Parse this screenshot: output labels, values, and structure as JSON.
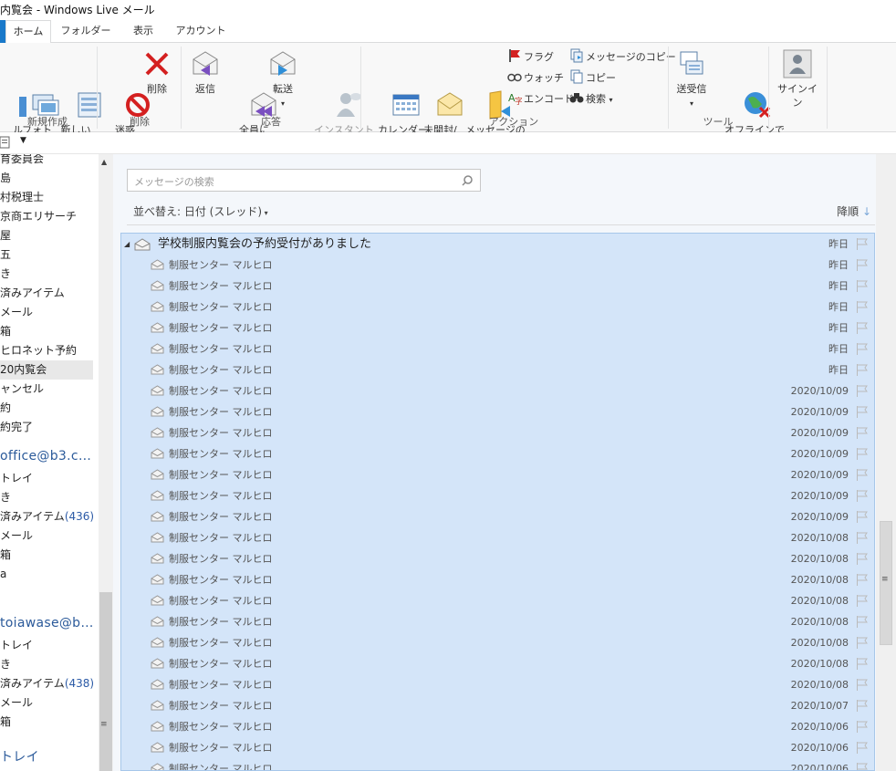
{
  "window": {
    "title": "内覧会 - Windows Live メール"
  },
  "tabs": [
    {
      "label": "ホーム",
      "active": true
    },
    {
      "label": "フォルダー"
    },
    {
      "label": "表示"
    },
    {
      "label": "アカウント"
    }
  ],
  "ribbon": {
    "new_group": {
      "btn1": "フォト\nメール",
      "btn2": "新しい\nアイテム",
      "label": "新規作成",
      "partial_left": "ル\nニ"
    },
    "delete_group": {
      "junk": "迷惑\nメール",
      "delete": "削除",
      "label": "削除"
    },
    "respond_group": {
      "reply": "返信",
      "reply_all": "全員に\n返信",
      "forward": "転送",
      "im": "インスタント\nメッセージ",
      "label": "応答"
    },
    "actions_group": {
      "calendar": "カレンダー\nに追加",
      "unread": "未開封/\n開封",
      "move": "メッセージの\n移動",
      "flag": "フラグ",
      "watch": "ウォッチ",
      "encode": "エンコード",
      "copy_msg": "メッセージのコピー",
      "copy": "コピー",
      "search": "検索",
      "label": "アクション"
    },
    "tools_group": {
      "sendrecv": "送受信",
      "offline": "オフラインで\n作業",
      "label": "ツール"
    },
    "signin": {
      "label": "サインイン"
    }
  },
  "folders": [
    {
      "label": "育委員会"
    },
    {
      "label": "島"
    },
    {
      "label": "村税理士"
    },
    {
      "label": "京商エリサーチ"
    },
    {
      "label": "屋"
    },
    {
      "label": "五"
    },
    {
      "label": "き"
    },
    {
      "label": "済みアイテム"
    },
    {
      "label": "メール"
    },
    {
      "label": "箱"
    },
    {
      "label": "ヒロネット予約"
    },
    {
      "label": "20内覧会",
      "selected": true
    },
    {
      "label": "ャンセル"
    },
    {
      "label": "約"
    },
    {
      "label": "約完了"
    }
  ],
  "account1": {
    "name": "office@b3.c…",
    "folders": [
      {
        "label": "トレイ"
      },
      {
        "label": "き"
      },
      {
        "label": "済みアイテム",
        "count": "(436)"
      },
      {
        "label": "メール"
      },
      {
        "label": "箱"
      },
      {
        "label": "a"
      }
    ]
  },
  "account2": {
    "name": "toiawase@b…",
    "folders": [
      {
        "label": "トレイ"
      },
      {
        "label": "き"
      },
      {
        "label": "済みアイテム",
        "count": "(438)"
      },
      {
        "label": "メール"
      },
      {
        "label": "箱"
      }
    ]
  },
  "account3_partial": "トレイ",
  "search": {
    "placeholder": "メッセージの検索"
  },
  "sort": {
    "label": "並べ替え: 日付 (スレッド)",
    "order": "降順"
  },
  "thread": {
    "subject": "学校制服内覧会の予約受付がありました",
    "date": "昨日"
  },
  "messages": [
    {
      "from": "制服センター マルヒロ",
      "date": "昨日"
    },
    {
      "from": "制服センター マルヒロ",
      "date": "昨日"
    },
    {
      "from": "制服センター マルヒロ",
      "date": "昨日"
    },
    {
      "from": "制服センター マルヒロ",
      "date": "昨日"
    },
    {
      "from": "制服センター マルヒロ",
      "date": "昨日"
    },
    {
      "from": "制服センター マルヒロ",
      "date": "昨日"
    },
    {
      "from": "制服センター マルヒロ",
      "date": "2020/10/09"
    },
    {
      "from": "制服センター マルヒロ",
      "date": "2020/10/09"
    },
    {
      "from": "制服センター マルヒロ",
      "date": "2020/10/09"
    },
    {
      "from": "制服センター マルヒロ",
      "date": "2020/10/09"
    },
    {
      "from": "制服センター マルヒロ",
      "date": "2020/10/09"
    },
    {
      "from": "制服センター マルヒロ",
      "date": "2020/10/09"
    },
    {
      "from": "制服センター マルヒロ",
      "date": "2020/10/09"
    },
    {
      "from": "制服センター マルヒロ",
      "date": "2020/10/08"
    },
    {
      "from": "制服センター マルヒロ",
      "date": "2020/10/08"
    },
    {
      "from": "制服センター マルヒロ",
      "date": "2020/10/08"
    },
    {
      "from": "制服センター マルヒロ",
      "date": "2020/10/08"
    },
    {
      "from": "制服センター マルヒロ",
      "date": "2020/10/08"
    },
    {
      "from": "制服センター マルヒロ",
      "date": "2020/10/08"
    },
    {
      "from": "制服センター マルヒロ",
      "date": "2020/10/08"
    },
    {
      "from": "制服センター マルヒロ",
      "date": "2020/10/08"
    },
    {
      "from": "制服センター マルヒロ",
      "date": "2020/10/07"
    },
    {
      "from": "制服センター マルヒロ",
      "date": "2020/10/06"
    },
    {
      "from": "制服センター マルヒロ",
      "date": "2020/10/06"
    },
    {
      "from": "制服センター マルヒロ",
      "date": "2020/10/06"
    }
  ]
}
